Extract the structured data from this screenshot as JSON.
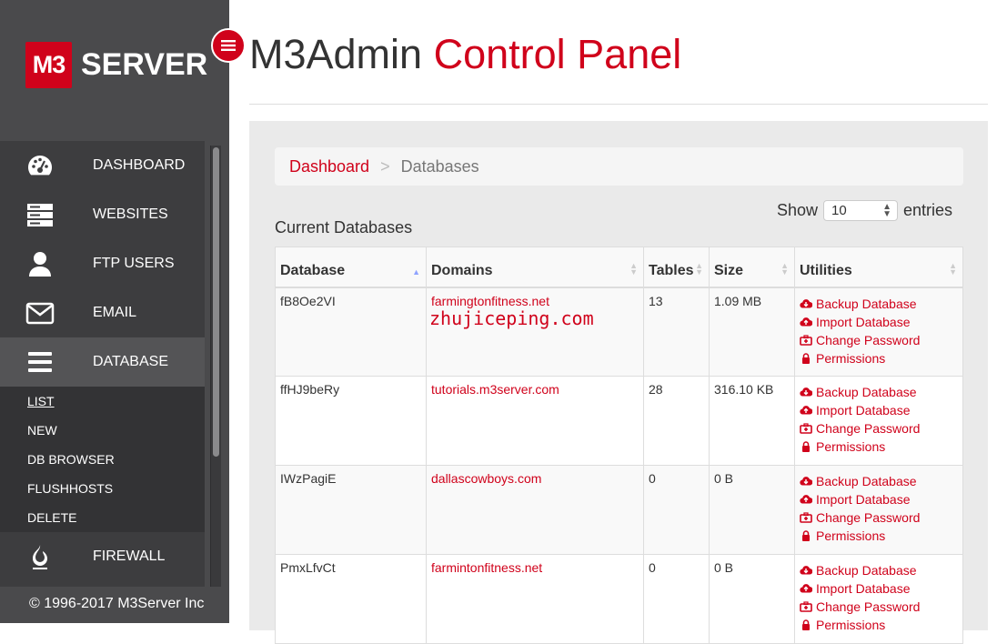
{
  "brand": {
    "logo_mark": "M3",
    "logo_text": "SERVER"
  },
  "header": {
    "title_main": "M3Admin",
    "title_accent": "Control Panel"
  },
  "sidebar": {
    "items": [
      {
        "label": "DASHBOARD",
        "icon": "dashboard-gauge-icon"
      },
      {
        "label": "WEBSITES",
        "icon": "server-stack-icon"
      },
      {
        "label": "FTP USERS",
        "icon": "user-icon"
      },
      {
        "label": "EMAIL",
        "icon": "envelope-icon"
      },
      {
        "label": "DATABASE",
        "icon": "bars-icon",
        "active": true
      }
    ],
    "database_submenu": [
      "LIST",
      "NEW",
      "DB BROWSER",
      "FLUSHHOSTS",
      "DELETE"
    ],
    "after_items": [
      {
        "label": "FIREWALL",
        "icon": "flame-icon"
      }
    ]
  },
  "footer": {
    "copyright": "© 1996-2017 M3Server Inc"
  },
  "breadcrumb": {
    "home": "Dashboard",
    "separator": ">",
    "current": "Databases"
  },
  "content": {
    "section_title": "Current Databases",
    "show_label": "Show",
    "entries_value": "10",
    "entries_label": "entries"
  },
  "table": {
    "columns": [
      "Database",
      "Domains",
      "Tables",
      "Size",
      "Utilities"
    ],
    "rows": [
      {
        "database": "fB8Oe2VI",
        "domain": "farmingtonfitness.net",
        "tables": "13",
        "size": "1.09 MB"
      },
      {
        "database": "ffHJ9beRy",
        "domain": "tutorials.m3server.com",
        "tables": "28",
        "size": "316.10 KB"
      },
      {
        "database": "IWzPagiE",
        "domain": "dallascowboys.com",
        "tables": "0",
        "size": "0 B"
      },
      {
        "database": "PmxLfvCt",
        "domain": "farmintonfitness.net",
        "tables": "0",
        "size": "0 B"
      }
    ],
    "utilities": [
      "Backup Database",
      "Import Database",
      "Change Password",
      "Permissions"
    ]
  },
  "watermark": "zhujiceping.com",
  "colors": {
    "accent": "#d0021b",
    "sidebar_bg": "#4a4a4c"
  }
}
